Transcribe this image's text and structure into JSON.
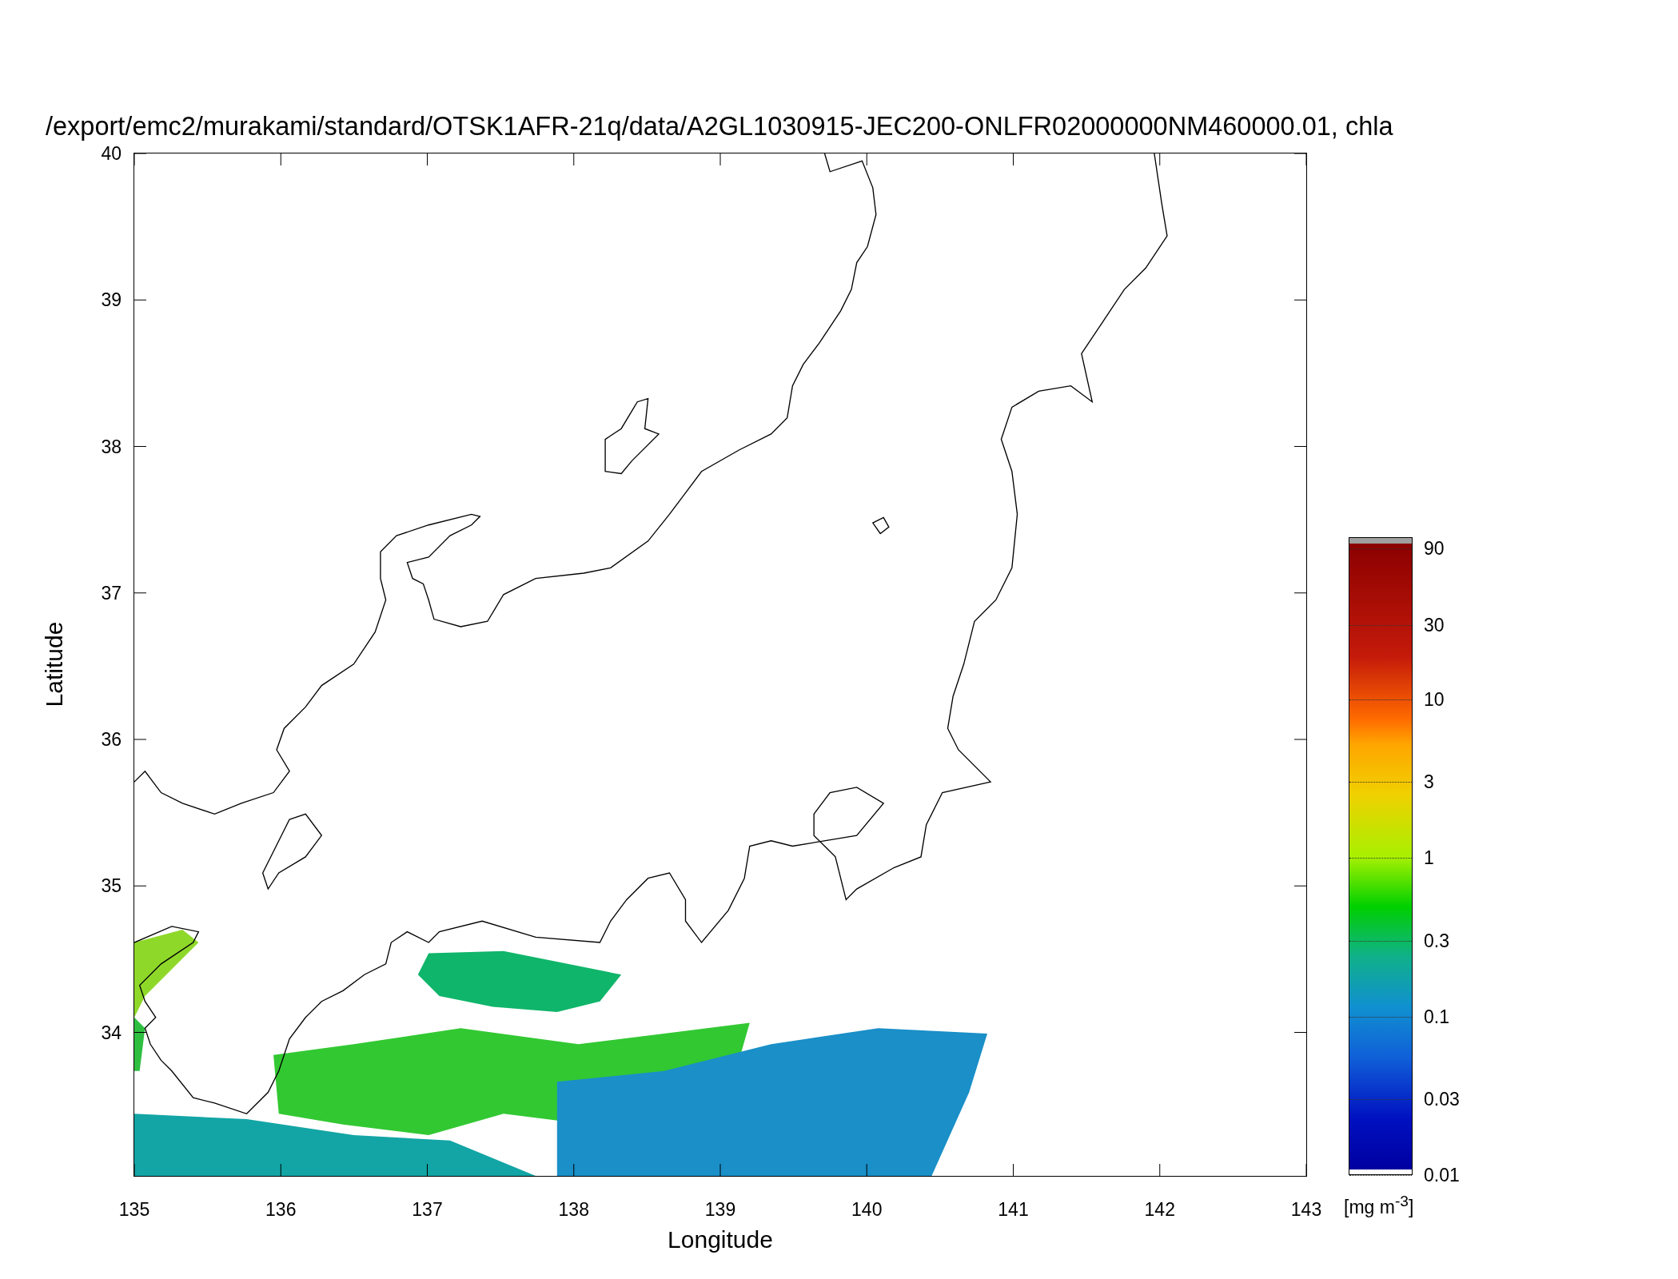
{
  "title": "/export/emc2/murakami/standard/OTSK1AFR-21q/data/A2GL1030915-JEC200-ONLFR02000000NM460000.01, chla",
  "y_axis": {
    "label": "Latitude",
    "ticks": [
      "40",
      "39",
      "38",
      "37",
      "36",
      "35",
      "34"
    ]
  },
  "x_axis": {
    "label": "Longitude",
    "ticks": [
      "135",
      "136",
      "137",
      "138",
      "139",
      "140",
      "141",
      "142",
      "143"
    ]
  },
  "colorbar": {
    "ticks": [
      "90",
      "30",
      "10",
      "3",
      "1",
      "0.3",
      "0.1",
      "0.03",
      "0.01"
    ],
    "unit": "[mg m$^{-3}$]"
  }
}
